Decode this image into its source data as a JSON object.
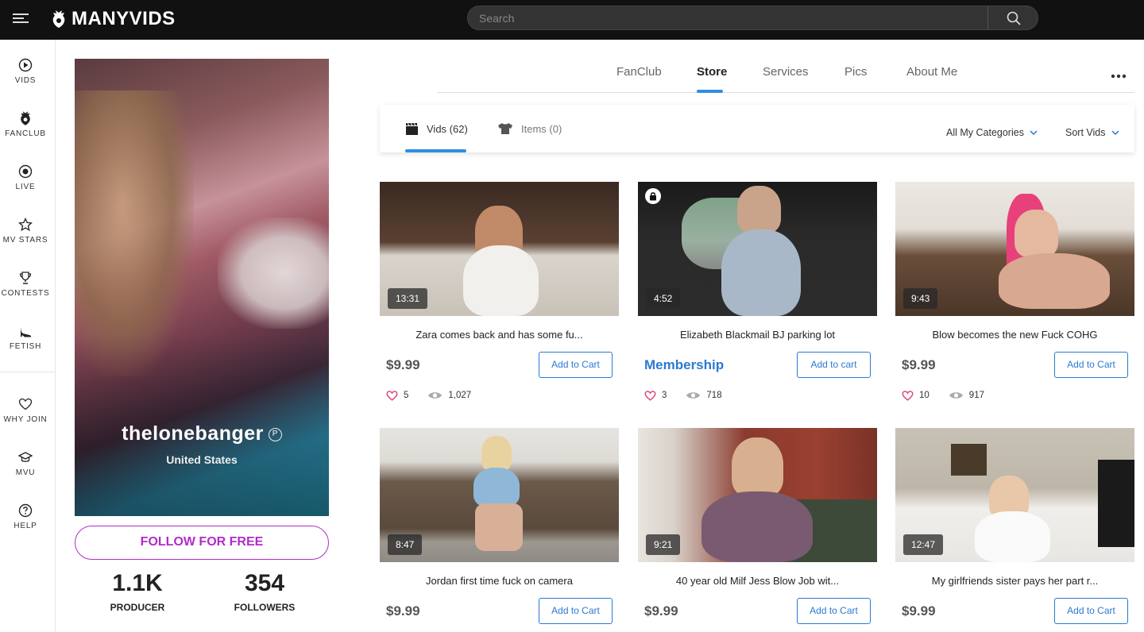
{
  "header": {
    "logo_text": "MANYVIDS",
    "search_placeholder": "Search"
  },
  "sidebar": {
    "items": [
      {
        "label": "VIDS",
        "icon": "play-circle-icon"
      },
      {
        "label": "FANCLUB",
        "icon": "fanclub-crest-icon"
      },
      {
        "label": "LIVE",
        "icon": "live-dot-icon"
      },
      {
        "label": "MV STARS",
        "icon": "star-icon"
      },
      {
        "label": "CONTESTS",
        "icon": "trophy-icon"
      },
      {
        "label": "FETISH",
        "icon": "high-heel-icon"
      },
      {
        "label": "WHY JOIN",
        "icon": "heart-icon"
      },
      {
        "label": "MVU",
        "icon": "graduation-cap-icon"
      },
      {
        "label": "HELP",
        "icon": "help-circle-icon"
      }
    ]
  },
  "profile": {
    "name": "thelonebanger",
    "badge": "P",
    "country": "United States",
    "follow_label": "FOLLOW FOR FREE",
    "stats": [
      {
        "value": "1.1K",
        "caption": "PRODUCER"
      },
      {
        "value": "354",
        "caption": "FOLLOWERS"
      }
    ]
  },
  "tabs": {
    "items": [
      "FanClub",
      "Store",
      "Services",
      "Pics",
      "About Me"
    ],
    "active": "Store"
  },
  "subtabs": {
    "vids": "Vids (62)",
    "items": "Items (0)",
    "categories": "All My Categories",
    "sort": "Sort Vids"
  },
  "videos": [
    {
      "duration": "13:31",
      "title": "Zara comes back and has some fu...",
      "price": "$9.99",
      "cart": "Add to Cart",
      "likes": "5",
      "views": "1,027",
      "locked": false
    },
    {
      "duration": "4:52",
      "title": "Elizabeth Blackmail BJ parking lot",
      "price": "Membership",
      "cart": "Add to cart",
      "likes": "3",
      "views": "718",
      "locked": true
    },
    {
      "duration": "9:43",
      "title": "Blow becomes the new Fuck COHG",
      "price": "$9.99",
      "cart": "Add to Cart",
      "likes": "10",
      "views": "917",
      "locked": false
    },
    {
      "duration": "8:47",
      "title": "Jordan first time fuck on camera",
      "price": "$9.99",
      "cart": "Add to Cart",
      "likes": "",
      "views": "",
      "locked": false
    },
    {
      "duration": "9:21",
      "title": "40 year old Milf Jess Blow Job wit...",
      "price": "$9.99",
      "cart": "Add to Cart",
      "likes": "",
      "views": "",
      "locked": false
    },
    {
      "duration": "12:47",
      "title": "My girlfriends sister pays her part r...",
      "price": "$9.99",
      "cart": "Add to Cart",
      "likes": "",
      "views": "",
      "locked": false
    }
  ],
  "colors": {
    "accent_blue": "#2a7ad2",
    "follow_purple": "#b12cc9",
    "heart_pink": "#e0457b"
  }
}
